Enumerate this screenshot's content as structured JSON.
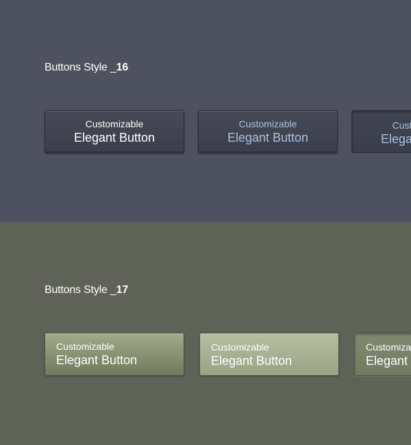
{
  "sections": [
    {
      "title_prefix": "Buttons Style _",
      "title_number": "16",
      "buttons": [
        {
          "line1": "Customizable",
          "line2": "Elegant Button"
        },
        {
          "line1": "Customizable",
          "line2": "Elegant Button"
        },
        {
          "line1": "Customizable",
          "line2": "Elegant Button"
        }
      ]
    },
    {
      "title_prefix": "Buttons Style _",
      "title_number": "17",
      "buttons": [
        {
          "line1": "Customizable",
          "line2": "Elegant Button"
        },
        {
          "line1": "Customizable",
          "line2": "Elegant Button"
        },
        {
          "line1": "Customizable",
          "line2": "Elegant Button"
        }
      ]
    }
  ],
  "colors": {
    "style16_background": "#4e515f",
    "style17_background": "#5f6357",
    "style16_hover_text": "#a9c2dd"
  }
}
